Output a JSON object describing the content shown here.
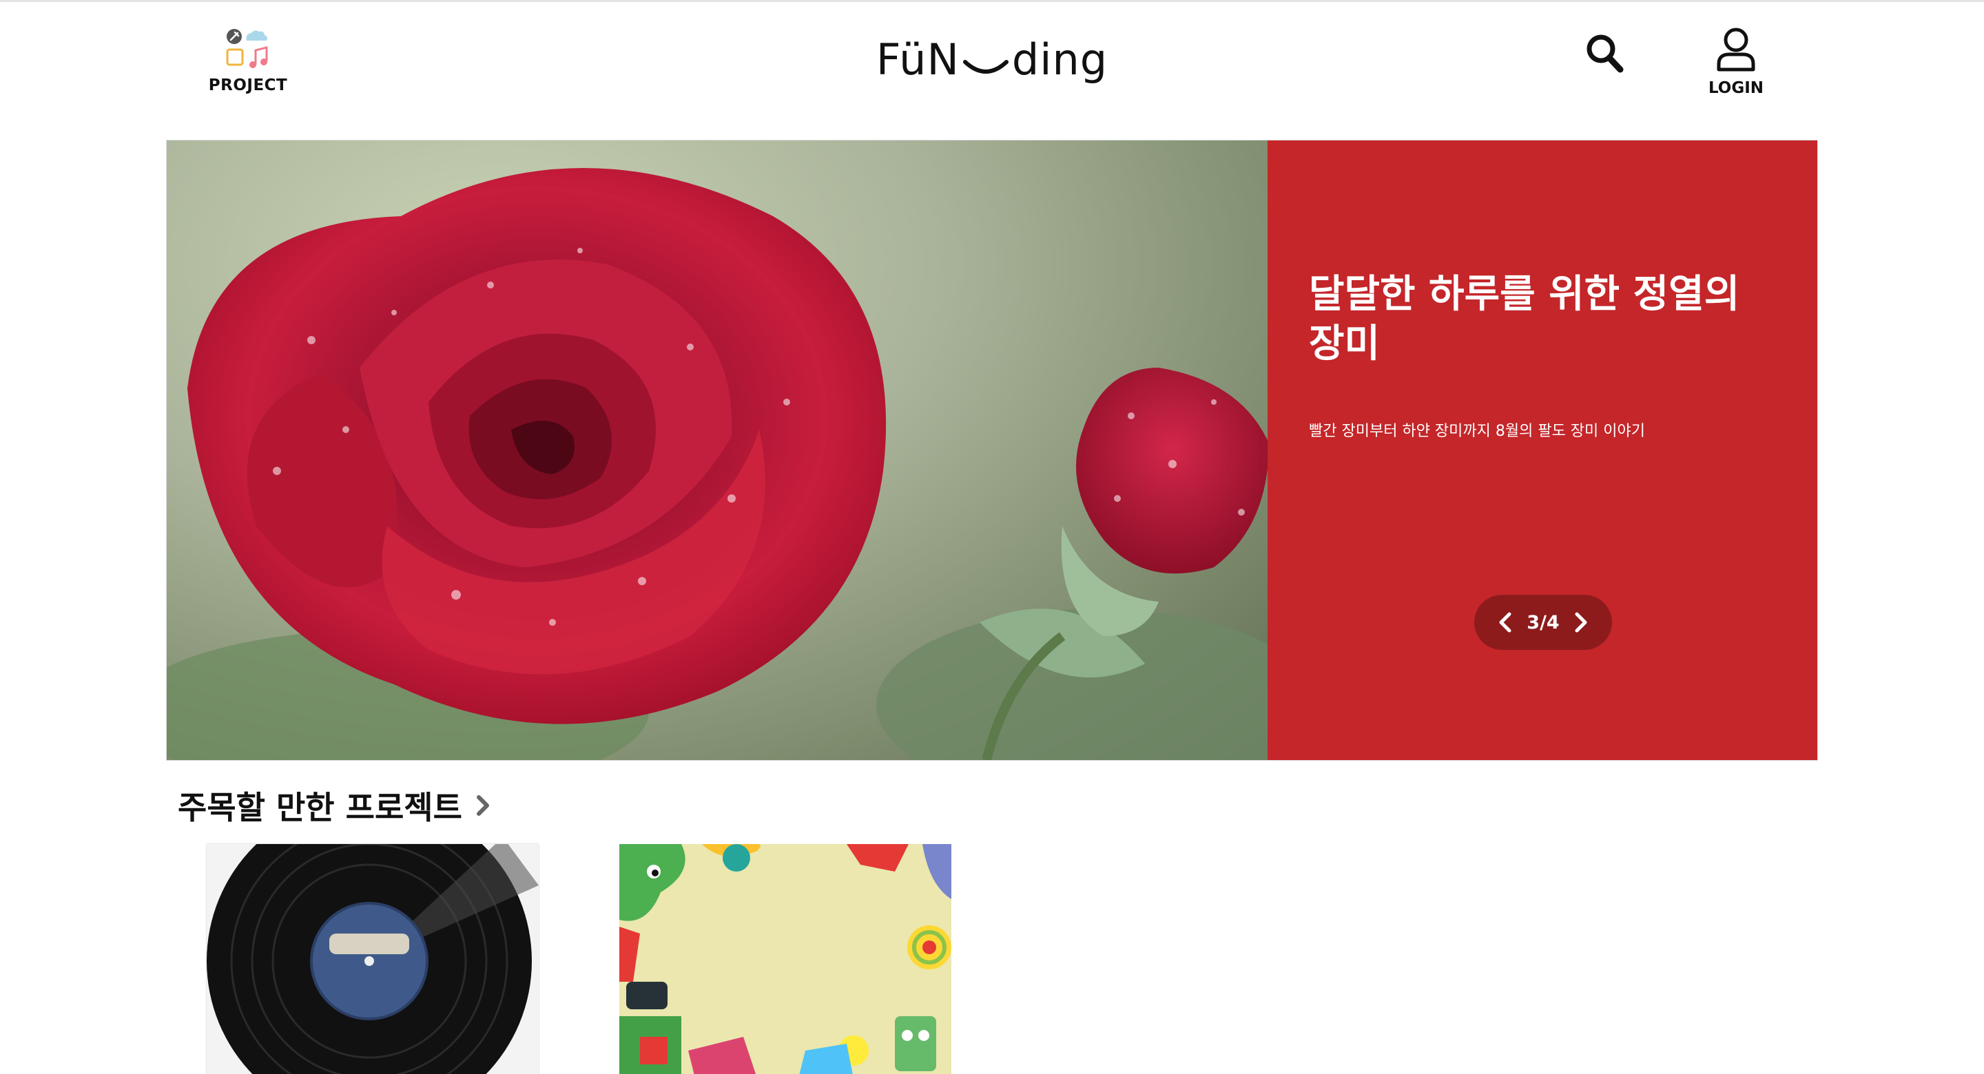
{
  "header": {
    "project_label": "PROJECT",
    "logo_left": "FüN",
    "logo_right": "ding",
    "login_label": "LOGIN",
    "icons": {
      "project": "project-category-icon",
      "search": "search-icon",
      "login": "user-icon"
    }
  },
  "hero": {
    "image": "red-rose-with-raindrops-photo",
    "title": "달달한 하루를 위한 정열의 장미",
    "subtitle": "빨간 장미부터 하얀 장미까지 8월의 팔도 장미 이야기",
    "pager": "3/4",
    "panel_color": "#c4262a",
    "pager_color": "#8d1b1c"
  },
  "featured": {
    "title": "주목할 만한 프로젝트",
    "cards": [
      {
        "image": "vinyl-record-photo"
      },
      {
        "image": "colorful-toy-illustration"
      }
    ]
  }
}
